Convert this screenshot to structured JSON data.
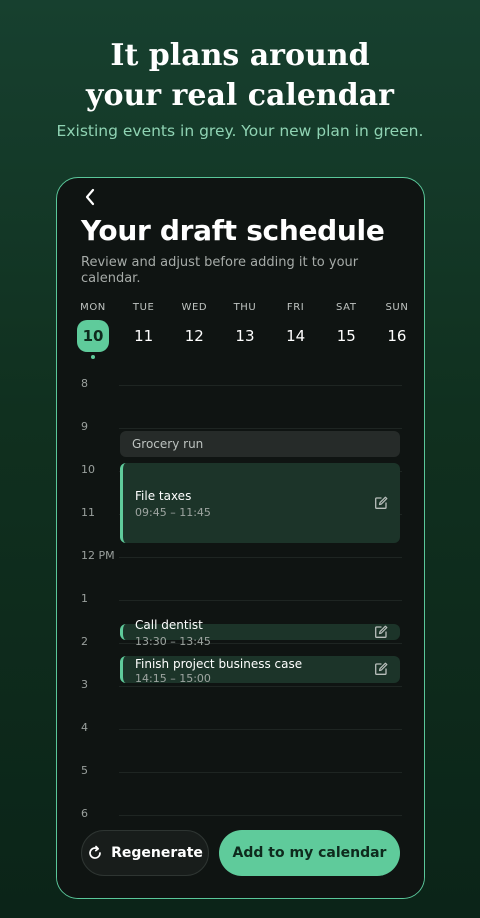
{
  "headline": {
    "line1": "It plans around",
    "line2": "your real calendar"
  },
  "subline": "Existing events in grey. Your new plan in green.",
  "screen": {
    "title": "Your draft schedule",
    "description": "Review and adjust before adding it to your calendar.",
    "week": [
      {
        "name": "MON",
        "num": "10",
        "active": true
      },
      {
        "name": "TUE",
        "num": "11"
      },
      {
        "name": "WED",
        "num": "12"
      },
      {
        "name": "THU",
        "num": "13"
      },
      {
        "name": "FRI",
        "num": "14"
      },
      {
        "name": "SAT",
        "num": "15"
      },
      {
        "name": "SUN",
        "num": "16"
      }
    ],
    "hours": [
      "8",
      "9",
      "10",
      "11",
      "12 PM",
      "1",
      "2",
      "3",
      "4",
      "5",
      "6"
    ],
    "events": {
      "grocery": {
        "title": "Grocery run"
      },
      "taxes": {
        "title": "File taxes",
        "time": "09:45 – 11:45"
      },
      "dentist": {
        "title": "Call dentist",
        "time": "13:30 – 13:45"
      },
      "project": {
        "title": "Finish project business case",
        "time": "14:15 – 15:00"
      }
    },
    "buttons": {
      "regenerate": "Regenerate",
      "add": "Add to my calendar"
    }
  },
  "colors": {
    "accent": "#5fcb9b",
    "existing_event": "#262b29",
    "plan_event": "#1c3429",
    "background": "#0f1412"
  }
}
